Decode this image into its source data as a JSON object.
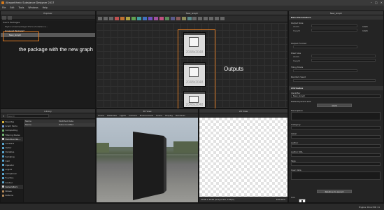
{
  "app": {
    "title": "Allegorithmic Substance Designer 2017",
    "window_controls": [
      "–",
      "□",
      "×"
    ]
  },
  "menu": [
    "File",
    "Edit",
    "Tools",
    "Windows",
    "Help"
  ],
  "explorer": {
    "title": "Explorer",
    "tree": [
      {
        "label": "User's Packages",
        "level": 0
      },
      {
        "label": "Mydocuments/Allegorithmic/Substance...",
        "level": 1
      },
      {
        "label": "Unsaved Package*",
        "level": 1,
        "highlight": true
      },
      {
        "label": "New_Graph",
        "level": 2,
        "selected": true
      }
    ],
    "annotation": "the package with the new graph"
  },
  "graph": {
    "title": "New_Graph",
    "nodes": [
      {
        "label": "2048x2048"
      },
      {
        "label": "2048x2048"
      },
      {
        "label": "2048x2048"
      }
    ],
    "annotation": "Outputs"
  },
  "library": {
    "title": "Library",
    "search_placeholder": "Search",
    "columns": [
      "Name",
      "Modified Date"
    ],
    "results": [
      {
        "name": "Name",
        "date": "Date modified"
      }
    ],
    "categories": [
      {
        "label": "Favorites",
        "color": "#d8b23a"
      },
      {
        "label": "Graph Items",
        "color": "#7aa0d4"
      },
      {
        "label": "Compositing",
        "color": "#6fb46f"
      },
      {
        "label": "Filtering Nodes",
        "color": "#6fb46f"
      },
      {
        "label": "Function No...",
        "color": "#cfcfcf",
        "bold": true
      },
      {
        "label": "Constant",
        "color": "#5aa6cf"
      },
      {
        "label": "Vector",
        "color": "#5aa6cf"
      },
      {
        "label": "Variables",
        "color": "#5aa6cf"
      },
      {
        "label": "Sampling",
        "color": "#5aa6cf"
      },
      {
        "label": "Cast",
        "color": "#5aa6cf"
      },
      {
        "label": "Operator",
        "color": "#5aa6cf"
      },
      {
        "label": "Logical",
        "color": "#5aa6cf"
      },
      {
        "label": "Comparison",
        "color": "#5aa6cf"
      },
      {
        "label": "Function",
        "color": "#5aa6cf"
      },
      {
        "label": "Control",
        "color": "#5aa6cf"
      },
      {
        "label": "Generators",
        "color": "#cfcfcf",
        "bold": true
      },
      {
        "label": "Noises",
        "color": "#b48a5a"
      },
      {
        "label": "Patterns",
        "color": "#b48a5a"
      }
    ]
  },
  "view3d": {
    "title": "3D View",
    "menu": [
      "Scene",
      "Materials",
      "Lights",
      "Camera",
      "Environment",
      "Scene",
      "Display",
      "Renderer"
    ]
  },
  "view2d": {
    "title": "2D View",
    "status": "2048 x 2048 (Grayscale, 16bpc)",
    "zoom": "100.00%"
  },
  "properties": {
    "title": "New_Graph",
    "sections": {
      "base_params": "Base Parameters",
      "output_size": "Output Size",
      "width": "Width",
      "height": "Height",
      "size_value": "1024",
      "relative": "Relative to parent",
      "output_format": "Output Format",
      "pixel_size": "Pixel Size",
      "tiling_mode": "Tiling Mode",
      "random_seed": "Random Seed",
      "attributes": "Attributes",
      "identifier": "Identifier",
      "identifier_value": "New_Graph",
      "default_parent": "Default parent size",
      "description": "Description",
      "category": "Category",
      "label": "Label",
      "author": "Author",
      "author_url": "Author URL",
      "tags": "Tags",
      "user_data": "User data",
      "icon": "Icon"
    }
  },
  "statusbar": {
    "engine": "Engine: Direct3D 11"
  }
}
